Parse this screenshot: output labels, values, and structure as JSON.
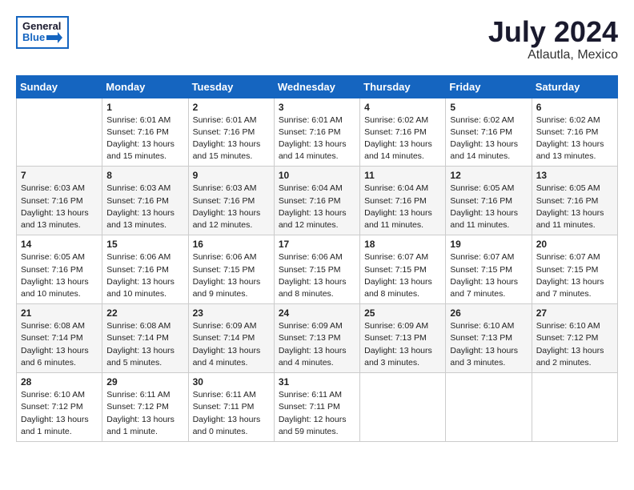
{
  "header": {
    "logo_line1": "General",
    "logo_line2": "Blue",
    "month_year": "July 2024",
    "location": "Atlautla, Mexico"
  },
  "weekdays": [
    "Sunday",
    "Monday",
    "Tuesday",
    "Wednesday",
    "Thursday",
    "Friday",
    "Saturday"
  ],
  "weeks": [
    [
      {
        "day": "",
        "info": ""
      },
      {
        "day": "1",
        "info": "Sunrise: 6:01 AM\nSunset: 7:16 PM\nDaylight: 13 hours\nand 15 minutes."
      },
      {
        "day": "2",
        "info": "Sunrise: 6:01 AM\nSunset: 7:16 PM\nDaylight: 13 hours\nand 15 minutes."
      },
      {
        "day": "3",
        "info": "Sunrise: 6:01 AM\nSunset: 7:16 PM\nDaylight: 13 hours\nand 14 minutes."
      },
      {
        "day": "4",
        "info": "Sunrise: 6:02 AM\nSunset: 7:16 PM\nDaylight: 13 hours\nand 14 minutes."
      },
      {
        "day": "5",
        "info": "Sunrise: 6:02 AM\nSunset: 7:16 PM\nDaylight: 13 hours\nand 14 minutes."
      },
      {
        "day": "6",
        "info": "Sunrise: 6:02 AM\nSunset: 7:16 PM\nDaylight: 13 hours\nand 13 minutes."
      }
    ],
    [
      {
        "day": "7",
        "info": "Sunrise: 6:03 AM\nSunset: 7:16 PM\nDaylight: 13 hours\nand 13 minutes."
      },
      {
        "day": "8",
        "info": "Sunrise: 6:03 AM\nSunset: 7:16 PM\nDaylight: 13 hours\nand 13 minutes."
      },
      {
        "day": "9",
        "info": "Sunrise: 6:03 AM\nSunset: 7:16 PM\nDaylight: 13 hours\nand 12 minutes."
      },
      {
        "day": "10",
        "info": "Sunrise: 6:04 AM\nSunset: 7:16 PM\nDaylight: 13 hours\nand 12 minutes."
      },
      {
        "day": "11",
        "info": "Sunrise: 6:04 AM\nSunset: 7:16 PM\nDaylight: 13 hours\nand 11 minutes."
      },
      {
        "day": "12",
        "info": "Sunrise: 6:05 AM\nSunset: 7:16 PM\nDaylight: 13 hours\nand 11 minutes."
      },
      {
        "day": "13",
        "info": "Sunrise: 6:05 AM\nSunset: 7:16 PM\nDaylight: 13 hours\nand 11 minutes."
      }
    ],
    [
      {
        "day": "14",
        "info": "Sunrise: 6:05 AM\nSunset: 7:16 PM\nDaylight: 13 hours\nand 10 minutes."
      },
      {
        "day": "15",
        "info": "Sunrise: 6:06 AM\nSunset: 7:16 PM\nDaylight: 13 hours\nand 10 minutes."
      },
      {
        "day": "16",
        "info": "Sunrise: 6:06 AM\nSunset: 7:15 PM\nDaylight: 13 hours\nand 9 minutes."
      },
      {
        "day": "17",
        "info": "Sunrise: 6:06 AM\nSunset: 7:15 PM\nDaylight: 13 hours\nand 8 minutes."
      },
      {
        "day": "18",
        "info": "Sunrise: 6:07 AM\nSunset: 7:15 PM\nDaylight: 13 hours\nand 8 minutes."
      },
      {
        "day": "19",
        "info": "Sunrise: 6:07 AM\nSunset: 7:15 PM\nDaylight: 13 hours\nand 7 minutes."
      },
      {
        "day": "20",
        "info": "Sunrise: 6:07 AM\nSunset: 7:15 PM\nDaylight: 13 hours\nand 7 minutes."
      }
    ],
    [
      {
        "day": "21",
        "info": "Sunrise: 6:08 AM\nSunset: 7:14 PM\nDaylight: 13 hours\nand 6 minutes."
      },
      {
        "day": "22",
        "info": "Sunrise: 6:08 AM\nSunset: 7:14 PM\nDaylight: 13 hours\nand 5 minutes."
      },
      {
        "day": "23",
        "info": "Sunrise: 6:09 AM\nSunset: 7:14 PM\nDaylight: 13 hours\nand 4 minutes."
      },
      {
        "day": "24",
        "info": "Sunrise: 6:09 AM\nSunset: 7:13 PM\nDaylight: 13 hours\nand 4 minutes."
      },
      {
        "day": "25",
        "info": "Sunrise: 6:09 AM\nSunset: 7:13 PM\nDaylight: 13 hours\nand 3 minutes."
      },
      {
        "day": "26",
        "info": "Sunrise: 6:10 AM\nSunset: 7:13 PM\nDaylight: 13 hours\nand 3 minutes."
      },
      {
        "day": "27",
        "info": "Sunrise: 6:10 AM\nSunset: 7:12 PM\nDaylight: 13 hours\nand 2 minutes."
      }
    ],
    [
      {
        "day": "28",
        "info": "Sunrise: 6:10 AM\nSunset: 7:12 PM\nDaylight: 13 hours\nand 1 minute."
      },
      {
        "day": "29",
        "info": "Sunrise: 6:11 AM\nSunset: 7:12 PM\nDaylight: 13 hours\nand 1 minute."
      },
      {
        "day": "30",
        "info": "Sunrise: 6:11 AM\nSunset: 7:11 PM\nDaylight: 13 hours\nand 0 minutes."
      },
      {
        "day": "31",
        "info": "Sunrise: 6:11 AM\nSunset: 7:11 PM\nDaylight: 12 hours\nand 59 minutes."
      },
      {
        "day": "",
        "info": ""
      },
      {
        "day": "",
        "info": ""
      },
      {
        "day": "",
        "info": ""
      }
    ]
  ]
}
